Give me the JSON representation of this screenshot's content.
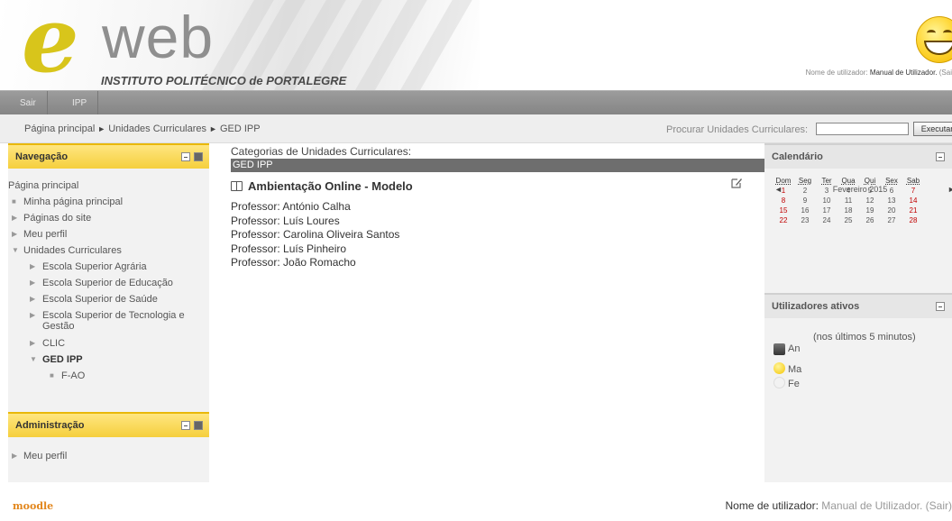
{
  "header": {
    "logo_letter": "e",
    "logo_word": "web",
    "institution": "INSTITUTO POLITÉCNICO de PORTALEGRE",
    "login_prefix": "Nome de utilizador:",
    "login_user": "Manual de Utilizador.",
    "login_logout": "(Sai"
  },
  "menubar": {
    "items": [
      {
        "label": "Sair"
      },
      {
        "label": "IPP"
      }
    ]
  },
  "breadcrumb": {
    "items": [
      "Página principal",
      "Unidades Curriculares",
      "GED IPP"
    ],
    "separator": "►"
  },
  "search": {
    "label": "Procurar Unidades Curriculares:",
    "value": "",
    "button_label": "Executar"
  },
  "navigation": {
    "title": "Navegação",
    "items": [
      {
        "label": "Página principal"
      },
      {
        "label": "Minha página principal"
      },
      {
        "label": "Páginas do site"
      },
      {
        "label": "Meu perfil"
      },
      {
        "label": "Unidades Curriculares"
      },
      {
        "label": "Escola Superior Agrária"
      },
      {
        "label": "Escola Superior de Educação"
      },
      {
        "label": "Escola Superior de Saúde"
      },
      {
        "label": "Escola Superior de Tecnologia e"
      },
      {
        "label": "Gestão"
      },
      {
        "label": "CLIC"
      },
      {
        "label": "GED IPP"
      },
      {
        "label": "F-AO"
      }
    ]
  },
  "administration": {
    "title": "Administração",
    "items": [
      {
        "label": "Meu perfil"
      }
    ]
  },
  "main": {
    "category_label": "Categorias de Unidades Curriculares:",
    "category_name": "GED IPP",
    "course_title": "Ambientação Online - Modelo",
    "teachers": [
      "Professor: António Calha",
      "Professor: Luís Loures",
      "Professor: Carolina Oliveira Santos",
      "Professor: Luís Pinheiro",
      "Professor: João Romacho"
    ]
  },
  "calendar": {
    "title": "Calendário",
    "prev": "◄",
    "next": "►",
    "month": "Fevereiro 2015",
    "weekdays": [
      "Dom",
      "Seg",
      "Ter",
      "Qua",
      "Qui",
      "Sex",
      "Sab"
    ],
    "weeks": [
      [
        "1",
        "2",
        "3",
        "4",
        "5",
        "6",
        "7"
      ],
      [
        "8",
        "9",
        "10",
        "11",
        "12",
        "13",
        "14"
      ],
      [
        "15",
        "16",
        "17",
        "18",
        "19",
        "20",
        "21"
      ],
      [
        "22",
        "23",
        "24",
        "25",
        "26",
        "27",
        "28"
      ]
    ],
    "weekend_color": "#c00000"
  },
  "active_users": {
    "title": "Utilizadores ativos",
    "period": "(nos últimos 5 minutos)",
    "users": [
      "An",
      "Ma",
      "Fe"
    ]
  },
  "footer": {
    "logo": "moodle",
    "login_prefix": "Nome de utilizador:",
    "login_user": "Manual de Utilizador.",
    "logout": "(Sair)"
  },
  "colors": {
    "block_header": "#f5cf3d",
    "menubar": "#8f8f8f",
    "category_bar": "#6e6e6e",
    "logo_e": "#d8c51b"
  }
}
